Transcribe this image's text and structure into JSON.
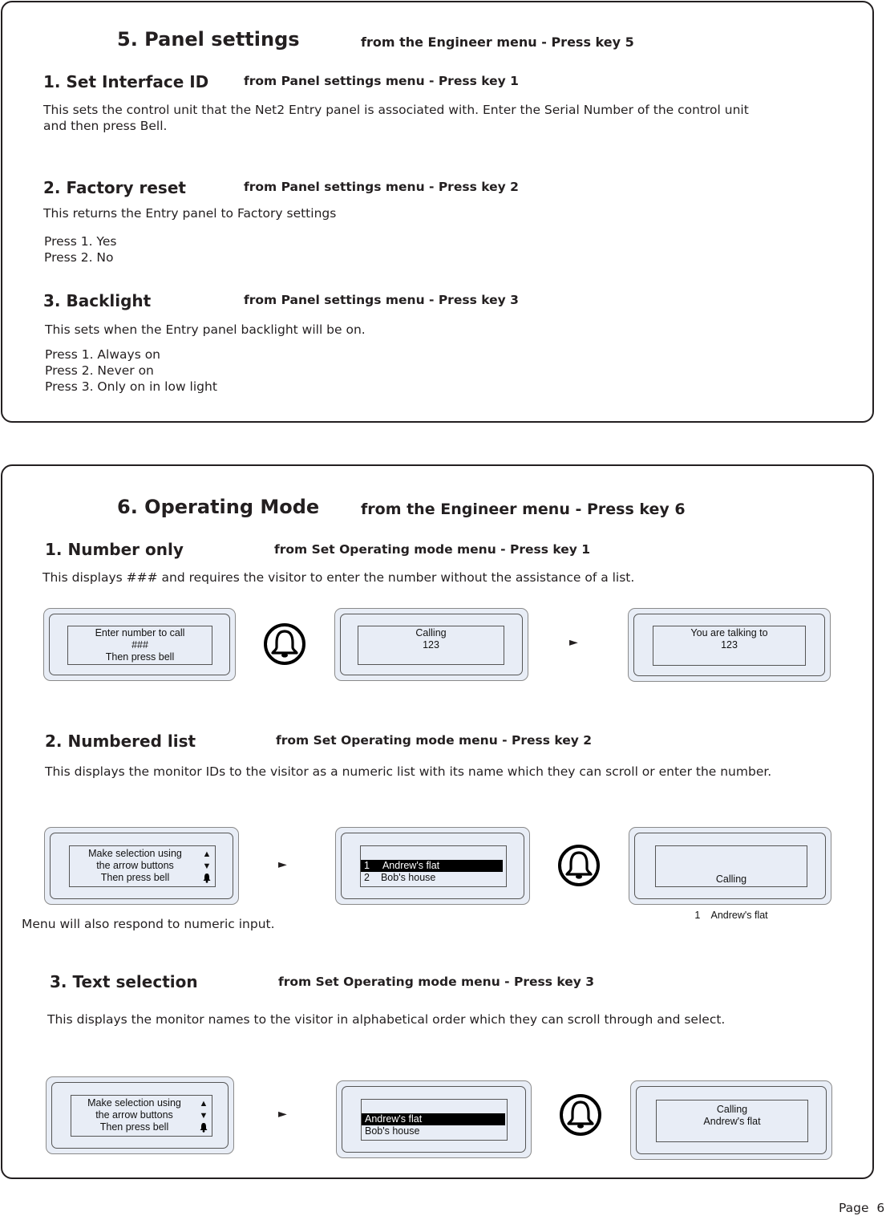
{
  "section5": {
    "title": "5. Panel settings",
    "subtitle": "from the Engineer menu - Press key 5",
    "items": [
      {
        "title": "1. Set Interface ID",
        "subtitle": "from Panel settings menu - Press key 1",
        "desc_line1": "This sets the control unit that the Net2 Entry panel is associated with. Enter the Serial Number of the control unit",
        "desc_line2": "and then press Bell."
      },
      {
        "title": "2. Factory reset",
        "subtitle": "from Panel settings menu - Press key 2",
        "desc": "This returns the Entry panel to Factory settings",
        "options": [
          "Press 1. Yes",
          "Press 2. No"
        ]
      },
      {
        "title": "3. Backlight",
        "subtitle": "from Panel settings menu - Press key 3",
        "desc": "This sets when the Entry panel backlight will be on.",
        "options": [
          "Press 1. Always on",
          "Press 2. Never on",
          "Press 3. Only on in low light"
        ]
      }
    ]
  },
  "section6": {
    "title": "6. Operating Mode",
    "subtitle": "from the Engineer menu - Press key 6",
    "items": [
      {
        "title": "1. Number only",
        "subtitle": "from Set Operating mode menu - Press key 1",
        "desc": "This displays ### and requires the visitor to enter the number without the assistance of a list.",
        "screens": [
          {
            "lines": [
              "Enter number to call",
              "###",
              "Then press bell"
            ]
          },
          {
            "lines": [
              "Calling",
              "123"
            ]
          },
          {
            "lines": [
              "You are talking to",
              "123"
            ]
          }
        ]
      },
      {
        "title": "2. Numbered list",
        "subtitle": "from Set Operating mode menu - Press key 2",
        "desc": "This displays the monitor IDs to the visitor as a numeric list with its name which they can scroll or enter the number.",
        "note": "Menu will also respond to numeric input.",
        "screens": [
          {
            "lines": [
              "Make selection using",
              "the arrow buttons",
              "Then press bell"
            ]
          },
          {
            "list": [
              {
                "num": "1",
                "name": "Andrew's flat",
                "selected": true
              },
              {
                "num": "2",
                "name": "Bob's house",
                "selected": false
              }
            ]
          },
          {
            "lines": [
              "Calling",
              "1    Andrew's flat"
            ]
          }
        ]
      },
      {
        "title": "3. Text selection",
        "subtitle": "from Set Operating mode menu - Press key 3",
        "desc": "This displays the monitor names to the visitor in alphabetical order which they can scroll through and select.",
        "screens": [
          {
            "lines": [
              "Make selection using",
              "the arrow buttons",
              "Then press bell"
            ]
          },
          {
            "list": [
              {
                "name": "Andrew's flat",
                "selected": true
              },
              {
                "name": "Bob's house",
                "selected": false
              }
            ]
          },
          {
            "lines": [
              "Calling",
              "Andrew's flat"
            ]
          }
        ]
      }
    ]
  },
  "icons": {
    "arrow_up": "▲",
    "arrow_down": "▼",
    "bell_small": "bell",
    "next": "►"
  },
  "footer": {
    "page": "Page  6"
  }
}
